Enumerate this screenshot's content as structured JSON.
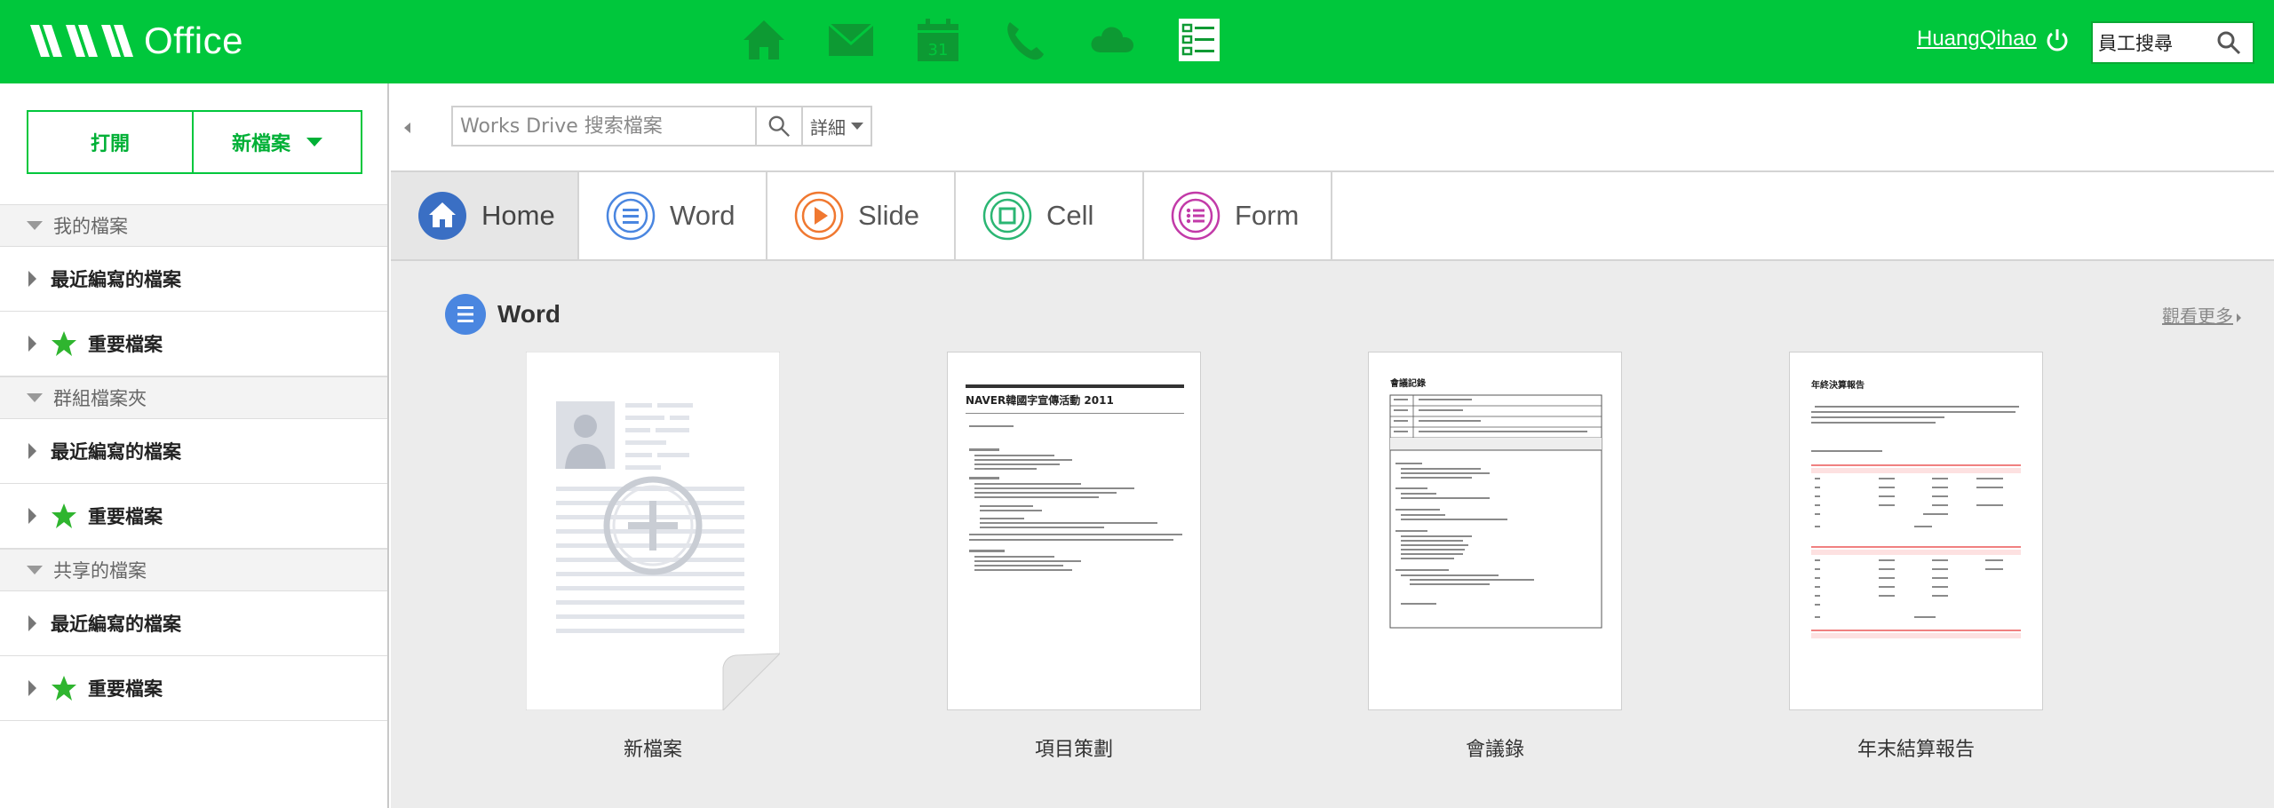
{
  "header": {
    "brand": "Office",
    "apps": [
      "home-icon",
      "mail-icon",
      "calendar-icon",
      "phone-icon",
      "cloud-icon",
      "task-icon"
    ],
    "calendar_day": "31",
    "username": "HuangQihao",
    "employee_search_value": "員工搜尋"
  },
  "sidebar": {
    "open_label": "打開",
    "new_label": "新檔案",
    "sections": [
      {
        "title": "我的檔案",
        "items": [
          {
            "label": "最近編寫的檔案",
            "star": false
          },
          {
            "label": "重要檔案",
            "star": true
          }
        ]
      },
      {
        "title": "群組檔案夾",
        "items": [
          {
            "label": "最近編寫的檔案",
            "star": false
          },
          {
            "label": "重要檔案",
            "star": true
          }
        ]
      },
      {
        "title": "共享的檔案",
        "items": [
          {
            "label": "最近編寫的檔案",
            "star": false
          },
          {
            "label": "重要檔案",
            "star": true
          }
        ]
      }
    ]
  },
  "search": {
    "placeholder": "Works Drive 搜索檔案",
    "detail_label": "詳細"
  },
  "tabs": [
    {
      "label": "Home",
      "color": "#3a6fc4",
      "icon": "home-tab-icon",
      "active": true
    },
    {
      "label": "Word",
      "color": "#4a86e0",
      "icon": "word-tab-icon",
      "active": false
    },
    {
      "label": "Slide",
      "color": "#f07830",
      "icon": "slide-tab-icon",
      "active": false
    },
    {
      "label": "Cell",
      "color": "#2bb673",
      "icon": "cell-tab-icon",
      "active": false
    },
    {
      "label": "Form",
      "color": "#c23aa8",
      "icon": "form-tab-icon",
      "active": false
    }
  ],
  "section": {
    "title": "Word",
    "see_more": "觀看更多"
  },
  "documents": [
    {
      "label": "新檔案",
      "kind": "new"
    },
    {
      "label": "項目策劃",
      "kind": "plan",
      "title": "NAVER韓國字宣傳活動 2011"
    },
    {
      "label": "會議錄",
      "kind": "minutes",
      "title": "會議記錄"
    },
    {
      "label": "年末結算報告",
      "kind": "report",
      "title": "年終決算報告"
    }
  ],
  "colors": {
    "brand_green": "#00c73c",
    "sidebar_button_text": "#00b036",
    "star": "#2fb52f",
    "content_bg": "#ececec"
  }
}
